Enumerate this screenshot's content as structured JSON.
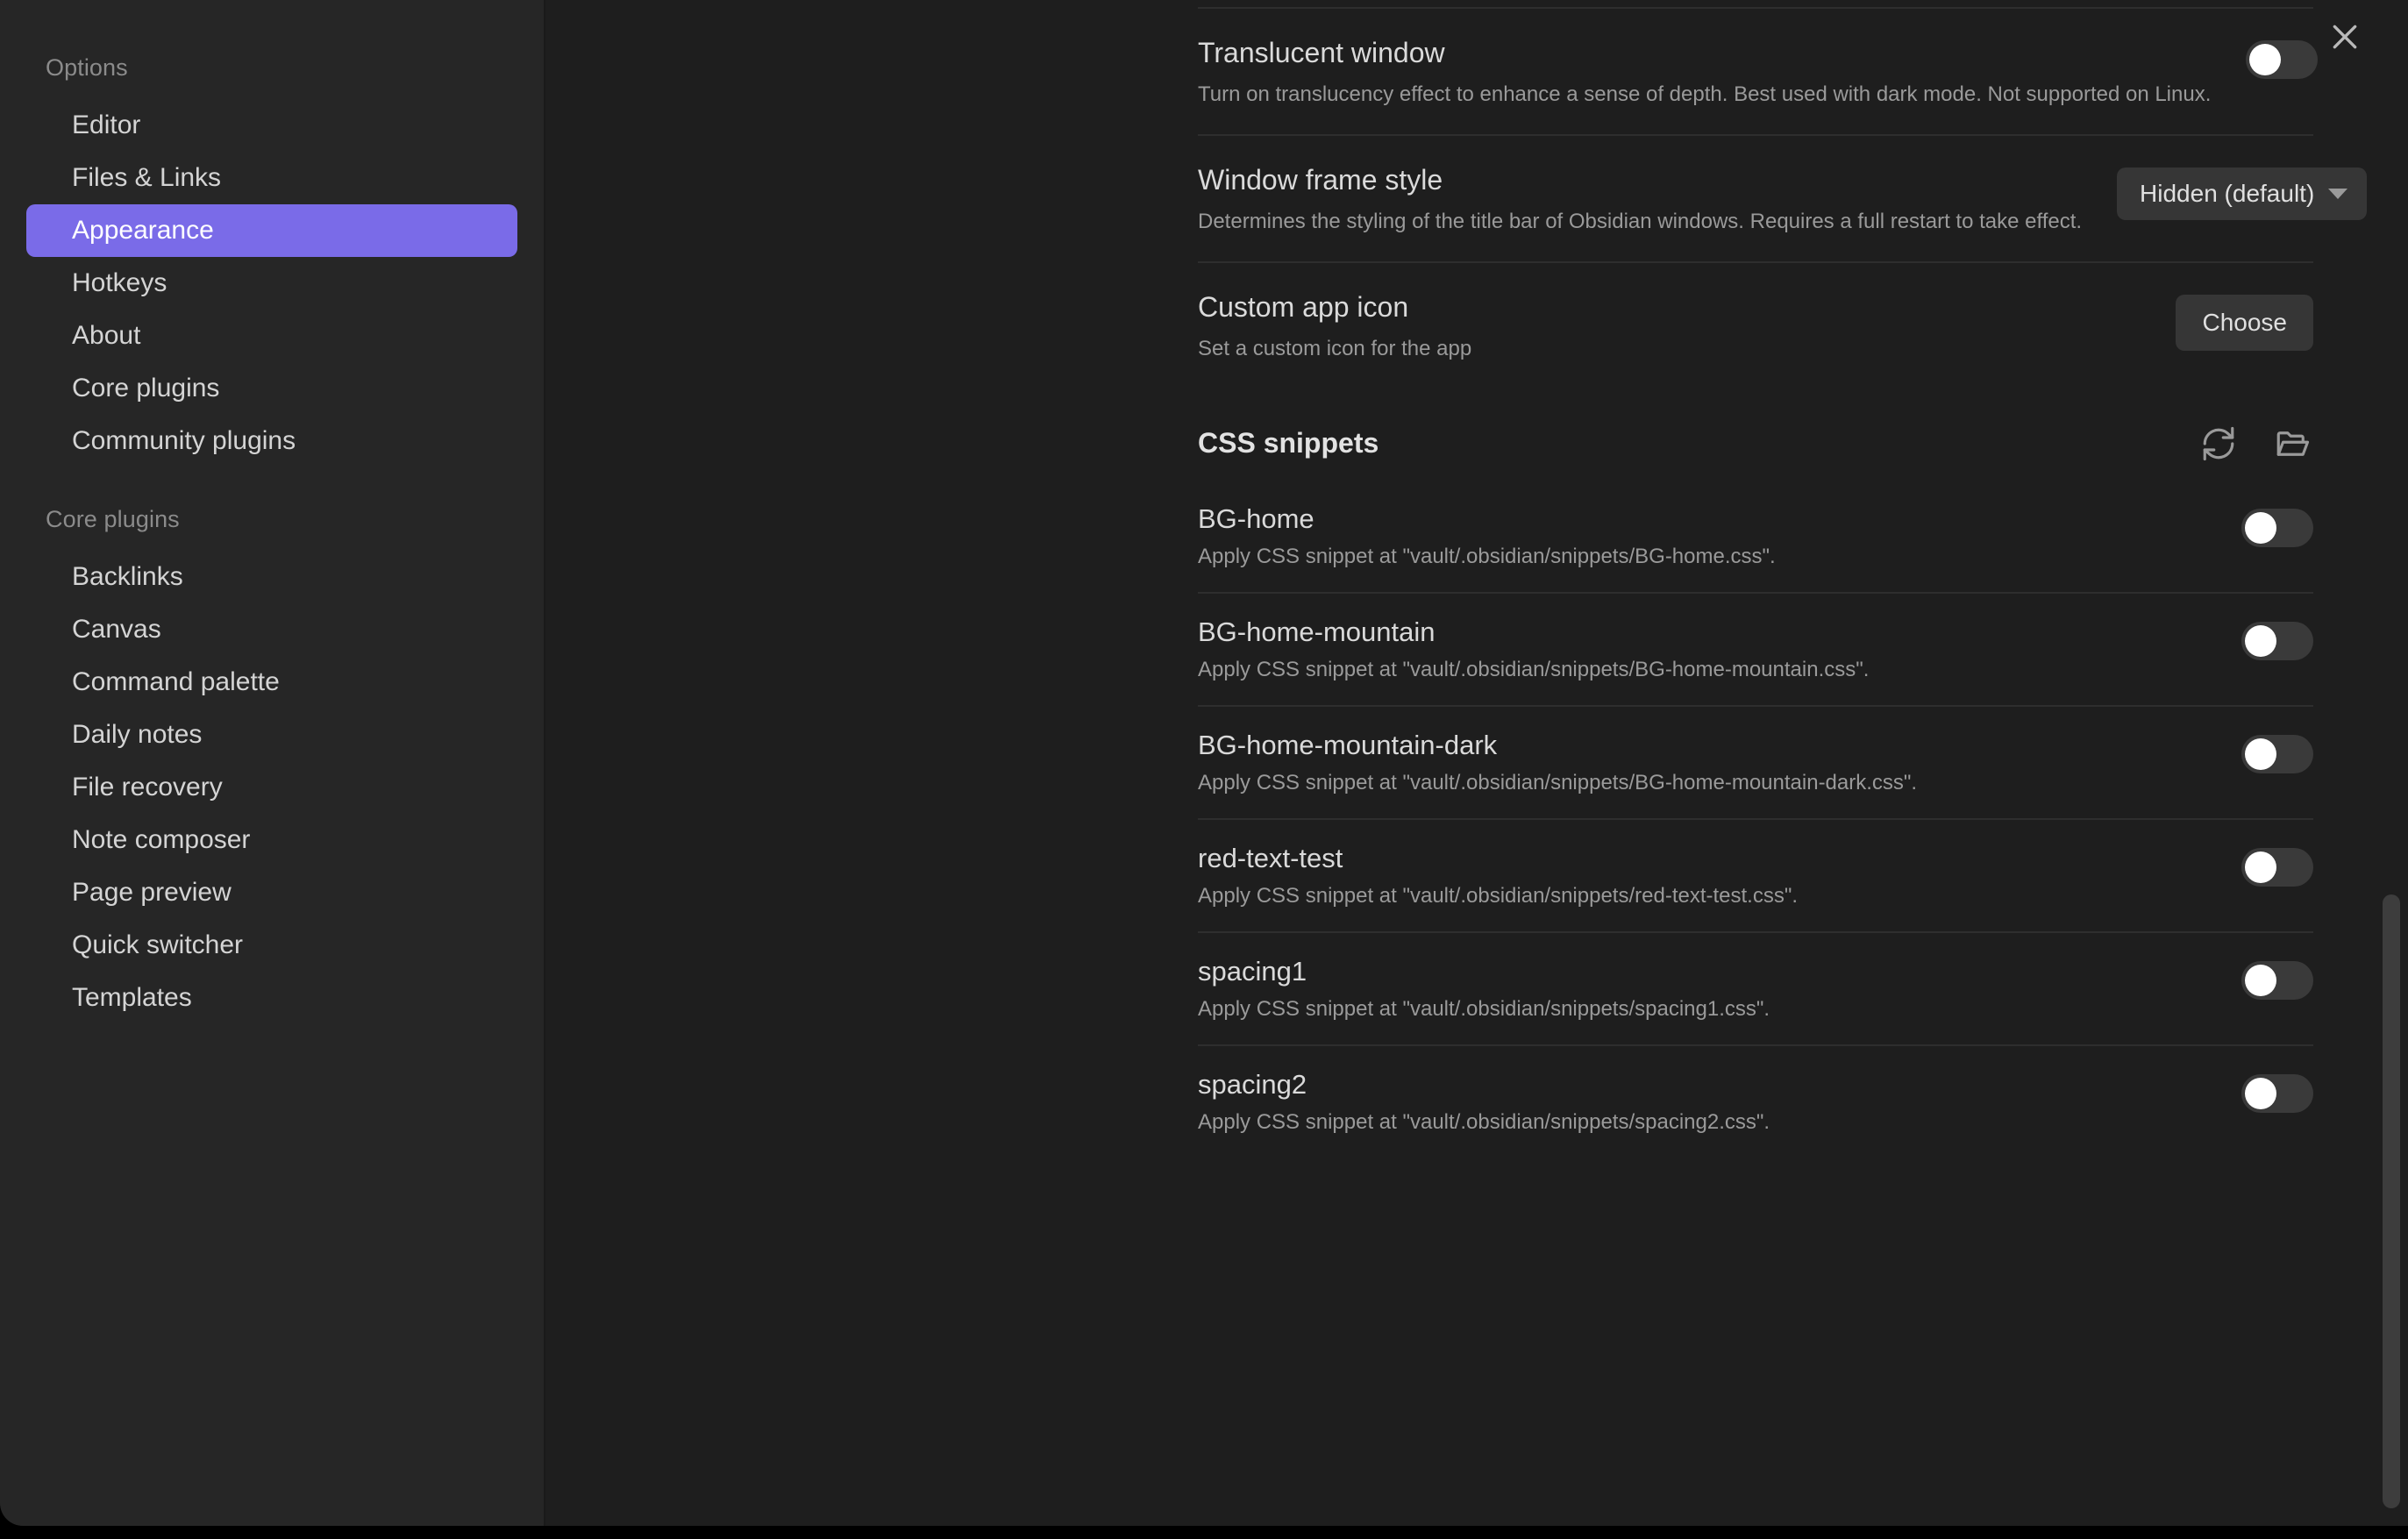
{
  "window": {
    "close_icon": "close-icon"
  },
  "sidebar": {
    "groups": [
      {
        "title": "Options",
        "items": [
          {
            "label": "Editor",
            "active": false
          },
          {
            "label": "Files & Links",
            "active": false
          },
          {
            "label": "Appearance",
            "active": true
          },
          {
            "label": "Hotkeys",
            "active": false
          },
          {
            "label": "About",
            "active": false
          },
          {
            "label": "Core plugins",
            "active": false
          },
          {
            "label": "Community plugins",
            "active": false
          }
        ]
      },
      {
        "title": "Core plugins",
        "items": [
          {
            "label": "Backlinks",
            "active": false
          },
          {
            "label": "Canvas",
            "active": false
          },
          {
            "label": "Command palette",
            "active": false
          },
          {
            "label": "Daily notes",
            "active": false
          },
          {
            "label": "File recovery",
            "active": false
          },
          {
            "label": "Note composer",
            "active": false
          },
          {
            "label": "Page preview",
            "active": false
          },
          {
            "label": "Quick switcher",
            "active": false
          },
          {
            "label": "Templates",
            "active": false
          }
        ]
      }
    ]
  },
  "main": {
    "clipped_top_text": "Turn on translucency effect to enhance a sense of depth. Best used with dark mode.",
    "settings": [
      {
        "name": "Translucent window",
        "desc": "Turn on translucency effect to enhance a sense of depth. Best used with dark mode. Not supported on Linux.",
        "control": "toggle",
        "value": "off"
      },
      {
        "name": "Window frame style",
        "desc": "Determines the styling of the title bar of Obsidian windows. Requires a full restart to take effect.",
        "control": "dropdown",
        "value": "Hidden (default)"
      },
      {
        "name": "Custom app icon",
        "desc": "Set a custom icon for the app",
        "control": "button",
        "value": "Choose"
      }
    ],
    "css_snippets": {
      "title": "CSS snippets",
      "reload_icon": "refresh-icon",
      "folder_icon": "folder-open-icon",
      "items": [
        {
          "name": "BG-home",
          "desc": "Apply CSS snippet at \"vault/.obsidian/snippets/BG-home.css\".",
          "enabled": "off"
        },
        {
          "name": "BG-home-mountain",
          "desc": "Apply CSS snippet at \"vault/.obsidian/snippets/BG-home-mountain.css\".",
          "enabled": "off"
        },
        {
          "name": "BG-home-mountain-dark",
          "desc": "Apply CSS snippet at \"vault/.obsidian/snippets/BG-home-mountain-dark.css\".",
          "enabled": "off"
        },
        {
          "name": "red-text-test",
          "desc": "Apply CSS snippet at \"vault/.obsidian/snippets/red-text-test.css\".",
          "enabled": "off"
        },
        {
          "name": "spacing1",
          "desc": "Apply CSS snippet at \"vault/.obsidian/snippets/spacing1.css\".",
          "enabled": "off"
        },
        {
          "name": "spacing2",
          "desc": "Apply CSS snippet at \"vault/.obsidian/snippets/spacing2.css\".",
          "enabled": "off"
        }
      ]
    }
  },
  "colors": {
    "accent": "#7a6be8",
    "sidebar_bg": "#262626",
    "content_bg": "#1e1e1e",
    "control_bg": "#363636",
    "divider": "#2e2e2e",
    "text_primary": "#dadada",
    "text_muted": "#9a9a9a"
  }
}
